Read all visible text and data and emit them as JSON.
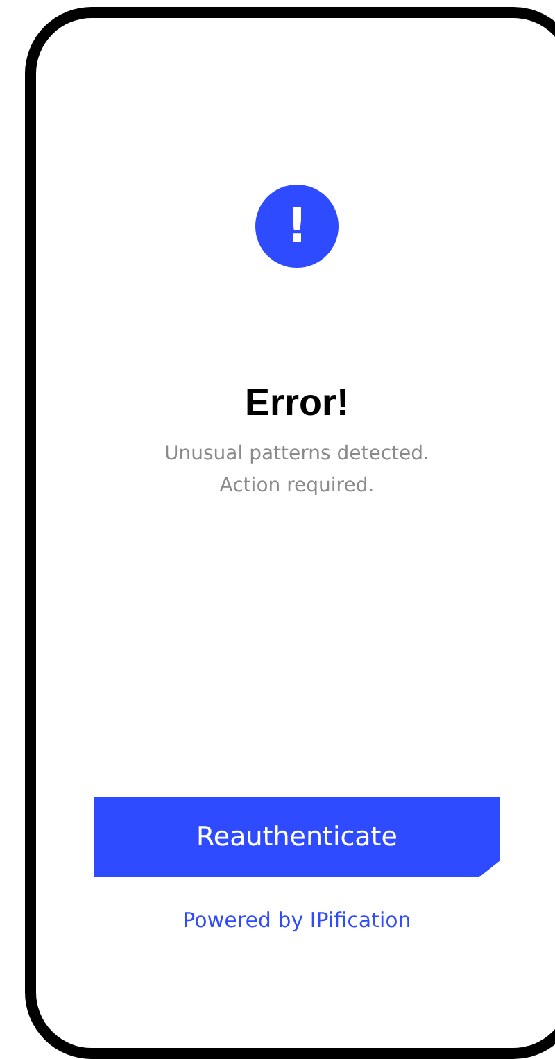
{
  "alert": {
    "icon": "!",
    "title": "Error!",
    "message": "Unusual patterns detected.\nAction required."
  },
  "button": {
    "label": "Reauthenticate"
  },
  "footer": {
    "link": "Powered by IPification"
  }
}
